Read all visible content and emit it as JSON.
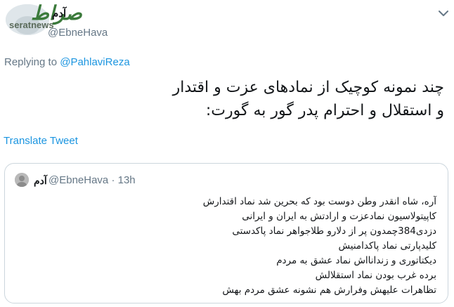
{
  "watermark": {
    "logo_text": "صراط",
    "site": "seratnews"
  },
  "tweet": {
    "display_name": "آدم",
    "handle": "@EbneHava",
    "replying_label": "Replying to",
    "replying_to": "@PahlaviReza",
    "text_lines": [
      "چند نمونه کوچیک از نمادهای عزت و اقتدار",
      "و استقلال و احترام پدر گور به گورت:"
    ],
    "translate_label": "Translate Tweet"
  },
  "quoted": {
    "display_name": "آدم",
    "handle_time": "@EbneHava · 13h",
    "lines": [
      "آره، شاه انقدر وطن دوست بود که بحرین شد نماد اقتدارش",
      "کاپیتولاسیون نمادعزت و ارادتش به ایران و ایرانی",
      "دزدی384چمدون پر از دلارو طلاجواهر نماد پاکدستی",
      "کلیدپارتی نماد پاکدامنیش",
      "دیکتاتوری و زندانااش نماد عشق به مردم",
      "برده غرب بودن نماد استقلالش",
      "تظاهرات علیهش وفرارش هم نشونه عشق مردم بهش"
    ]
  },
  "colors": {
    "link": "#1b95e0",
    "secondary": "#657786",
    "border": "#ccd6dd"
  },
  "icons": [
    "profile-avatar",
    "chevron-down-icon",
    "quoted-avatar"
  ]
}
